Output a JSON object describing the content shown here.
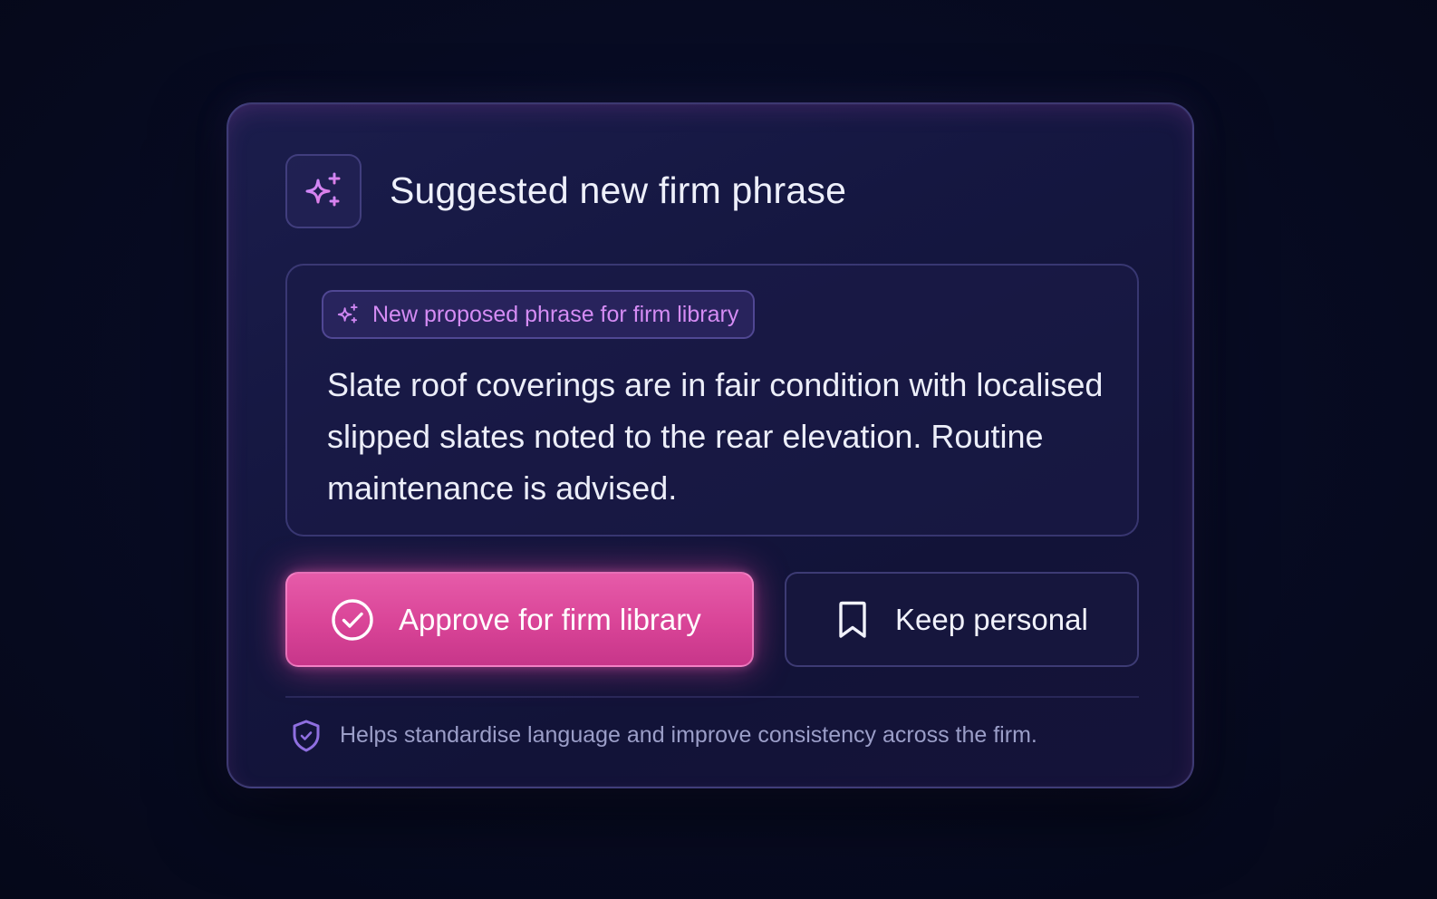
{
  "card": {
    "title": "Suggested new firm phrase",
    "header_icon": "sparkles-icon"
  },
  "phrase": {
    "tag_icon": "sparkles-icon",
    "tag_label": "New proposed phrase for firm library",
    "text": "Slate roof coverings are in fair condition with localised slipped slates noted to the rear elevation. Routine maintenance is advised."
  },
  "actions": {
    "approve_label": "Approve for firm library",
    "approve_icon": "check-circle-icon",
    "keep_label": "Keep personal",
    "keep_icon": "bookmark-icon"
  },
  "footer": {
    "icon": "shield-check-icon",
    "text": "Helps standardise language and improve consistency across the firm."
  },
  "colors": {
    "background": "#070b22",
    "card": "#16183f",
    "accent_pink": "#d94497",
    "accent_purple": "#c879f0",
    "tag_text": "#d58cf4",
    "muted_text": "#9b9ec8"
  }
}
